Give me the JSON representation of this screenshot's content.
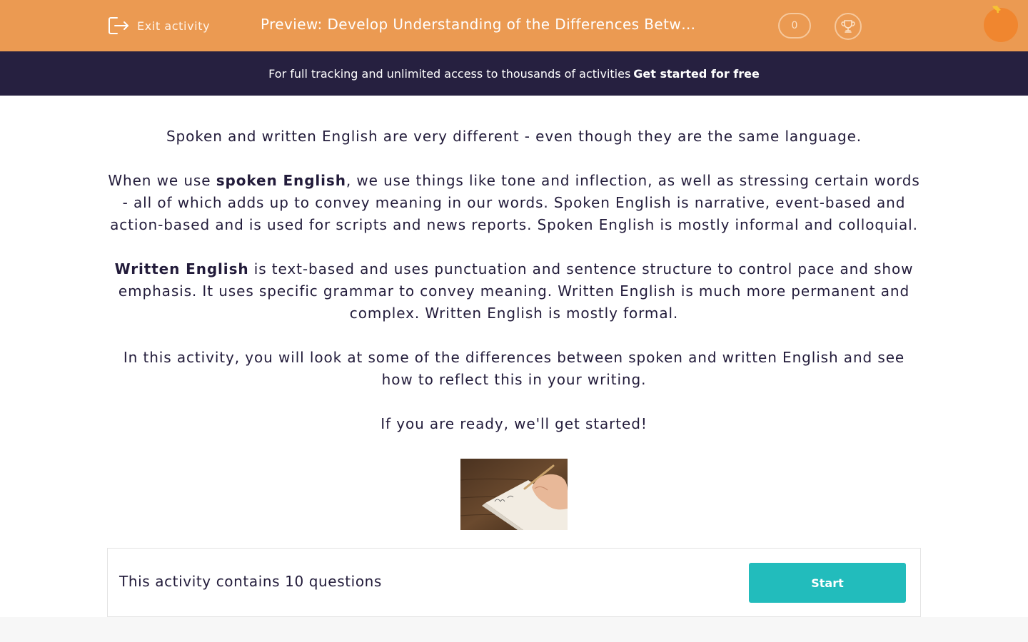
{
  "header": {
    "exit_label": "Exit activity",
    "title": "Preview: Develop Understanding of the Differences Between Spoken and Written English",
    "score": "0"
  },
  "banner": {
    "text": "For full tracking and unlimited access to thousands of activities",
    "cta": "Get started for free"
  },
  "intro": {
    "p1": "Spoken and written English are very different - even though they are the same language.",
    "p2_pre": "When we use ",
    "p2_bold": "spoken English",
    "p2_post": ", we use things like tone and inflection, as well as stressing certain words - all of which adds up to convey meaning in our words. Spoken English is narrative, event-based and action-based and is used for scripts and news reports. Spoken English is mostly informal and colloquial.",
    "p3_bold": "Written English",
    "p3_post": " is text-based and uses punctuation and sentence structure to control pace and show emphasis. It uses specific grammar to convey meaning. Written English is much more permanent and complex. Written English is mostly formal.",
    "p4": "In this activity, you will look at some of the differences between spoken and written English and see how to reflect this in your writing.",
    "p5": "If you are ready, we'll get started!"
  },
  "activity": {
    "summary": "This activity contains 10 questions",
    "start_label": "Start"
  },
  "colors": {
    "header_bg": "#eb9a52",
    "banner_bg": "#262040",
    "text": "#221b3a",
    "button": "#22bcbc"
  },
  "icons": {
    "exit": "exit-door-icon",
    "trophy": "trophy-icon",
    "logo": "orange-logo-icon"
  }
}
